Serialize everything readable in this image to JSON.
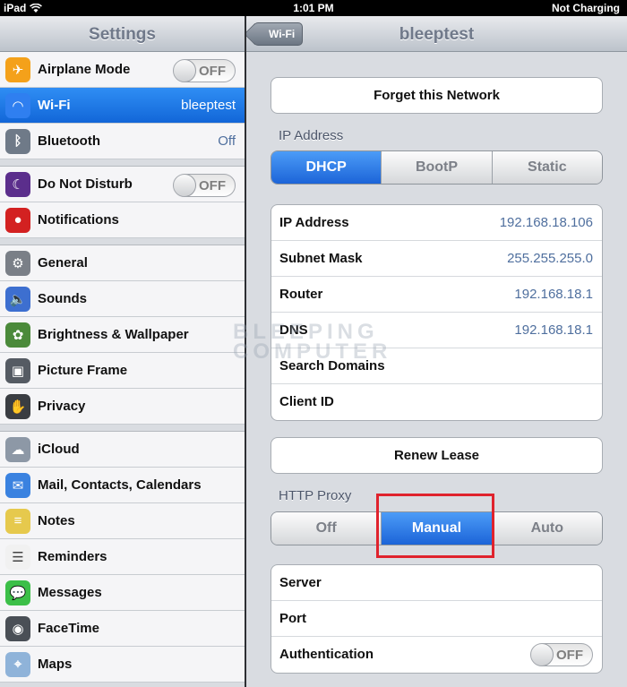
{
  "status": {
    "device": "iPad",
    "time": "1:01 PM",
    "battery": "Not Charging"
  },
  "settings": {
    "title": "Settings",
    "groups": [
      [
        {
          "label": "Airplane Mode",
          "toggle": "OFF",
          "icon": "airplane-icon",
          "color": "#f4a11a"
        },
        {
          "label": "Wi-Fi",
          "value": "bleeptest",
          "icon": "wifi-icon",
          "color": "#2f7ff0",
          "selected": true
        },
        {
          "label": "Bluetooth",
          "value": "Off",
          "icon": "bluetooth-icon",
          "color": "#6f7a88"
        }
      ],
      [
        {
          "label": "Do Not Disturb",
          "toggle": "OFF",
          "icon": "moon-icon",
          "color": "#5b2e8c"
        },
        {
          "label": "Notifications",
          "icon": "notifications-icon",
          "color": "#d32121"
        }
      ],
      [
        {
          "label": "General",
          "icon": "gear-icon",
          "color": "#7a7f87"
        },
        {
          "label": "Sounds",
          "icon": "speaker-icon",
          "color": "#3d6fd0"
        },
        {
          "label": "Brightness & Wallpaper",
          "icon": "flower-icon",
          "color": "#4b8a3a"
        },
        {
          "label": "Picture Frame",
          "icon": "picture-frame-icon",
          "color": "#555b63"
        },
        {
          "label": "Privacy",
          "icon": "hand-icon",
          "color": "#3a3d42"
        }
      ],
      [
        {
          "label": "iCloud",
          "icon": "cloud-icon",
          "color": "#8d98a6"
        },
        {
          "label": "Mail, Contacts, Calendars",
          "icon": "mail-icon",
          "color": "#3a82e0"
        },
        {
          "label": "Notes",
          "icon": "notes-icon",
          "color": "#e6c94d"
        },
        {
          "label": "Reminders",
          "icon": "reminders-icon",
          "color": "#f1f1f1"
        },
        {
          "label": "Messages",
          "icon": "messages-icon",
          "color": "#3cbf48"
        },
        {
          "label": "FaceTime",
          "icon": "facetime-icon",
          "color": "#4a4f56"
        },
        {
          "label": "Maps",
          "icon": "maps-icon",
          "color": "#8fb3d9"
        }
      ]
    ]
  },
  "detail": {
    "title": "bleeptest",
    "back": "Wi-Fi",
    "forget": "Forget this Network",
    "ip_header": "IP Address",
    "ip_modes": [
      "DHCP",
      "BootP",
      "Static"
    ],
    "rows": [
      {
        "k": "IP Address",
        "v": "192.168.18.106"
      },
      {
        "k": "Subnet Mask",
        "v": "255.255.255.0"
      },
      {
        "k": "Router",
        "v": "192.168.18.1"
      },
      {
        "k": "DNS",
        "v": "192.168.18.1"
      },
      {
        "k": "Search Domains",
        "v": ""
      },
      {
        "k": "Client ID",
        "v": ""
      }
    ],
    "renew": "Renew Lease",
    "proxy_header": "HTTP Proxy",
    "proxy_modes": [
      "Off",
      "Manual",
      "Auto"
    ],
    "proxy_rows": [
      {
        "k": "Server"
      },
      {
        "k": "Port"
      },
      {
        "k": "Authentication",
        "toggle": "OFF"
      }
    ]
  },
  "watermark": [
    "BLEEPING",
    "COMPUTER"
  ]
}
